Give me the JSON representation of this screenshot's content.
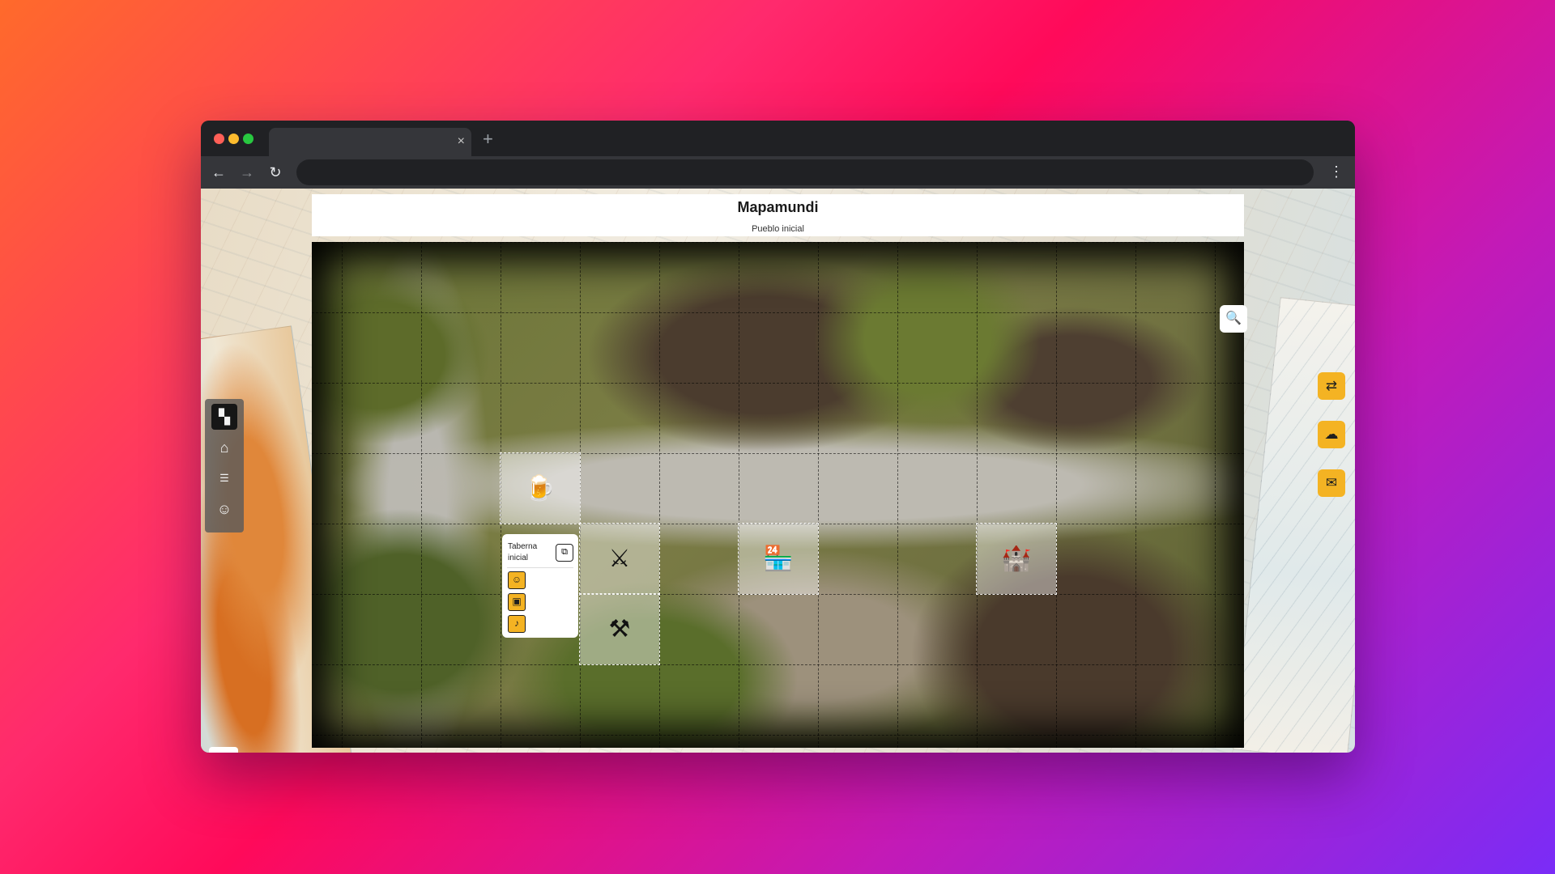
{
  "browser": {
    "tab_close": "×",
    "new_tab": "+",
    "back": "←",
    "forward": "→",
    "reload": "↻",
    "menu": "⋮"
  },
  "header": {
    "title": "Mapamundi",
    "subtitle": "Pueblo inicial"
  },
  "map": {
    "view_toggle_icon": "map-search-icon",
    "view_toggle_glyph": "🔍",
    "tiles": [
      {
        "name": "tavern",
        "icon": "tavern-sign-icon",
        "glyph": "🍺"
      },
      {
        "name": "crossed-swords",
        "icon": "crossed-swords-icon",
        "glyph": "⚔"
      },
      {
        "name": "shop",
        "icon": "market-stall-icon",
        "glyph": "🏪"
      },
      {
        "name": "castle",
        "icon": "castle-tower-icon",
        "glyph": "🏰"
      },
      {
        "name": "anvil",
        "icon": "anvil-icon",
        "glyph": "⚒"
      }
    ],
    "popup": {
      "title": "Taberna inicial",
      "enter_icon": "enter-building-icon",
      "enter_glyph": "⧉",
      "options": [
        {
          "icon": "person-icon",
          "glyph": "☺"
        },
        {
          "icon": "chest-icon",
          "glyph": "▣"
        },
        {
          "icon": "music-note-icon",
          "glyph": "♪"
        }
      ]
    }
  },
  "left_nav": [
    {
      "icon": "map-icon",
      "glyph": "▚",
      "active": true
    },
    {
      "icon": "home-icon",
      "glyph": "⌂",
      "active": false
    },
    {
      "icon": "list-icon",
      "glyph": "☰",
      "active": false
    },
    {
      "icon": "user-icon",
      "glyph": "☺",
      "active": false
    }
  ],
  "right_actions": [
    {
      "icon": "swap-icon",
      "glyph": "⇄"
    },
    {
      "icon": "cloud-icon",
      "glyph": "☁"
    },
    {
      "icon": "inventory-icon",
      "glyph": "✉"
    }
  ],
  "colors": {
    "accent": "#f4b323",
    "sidebar": "#5a5a5a",
    "chrome": "#202124"
  }
}
